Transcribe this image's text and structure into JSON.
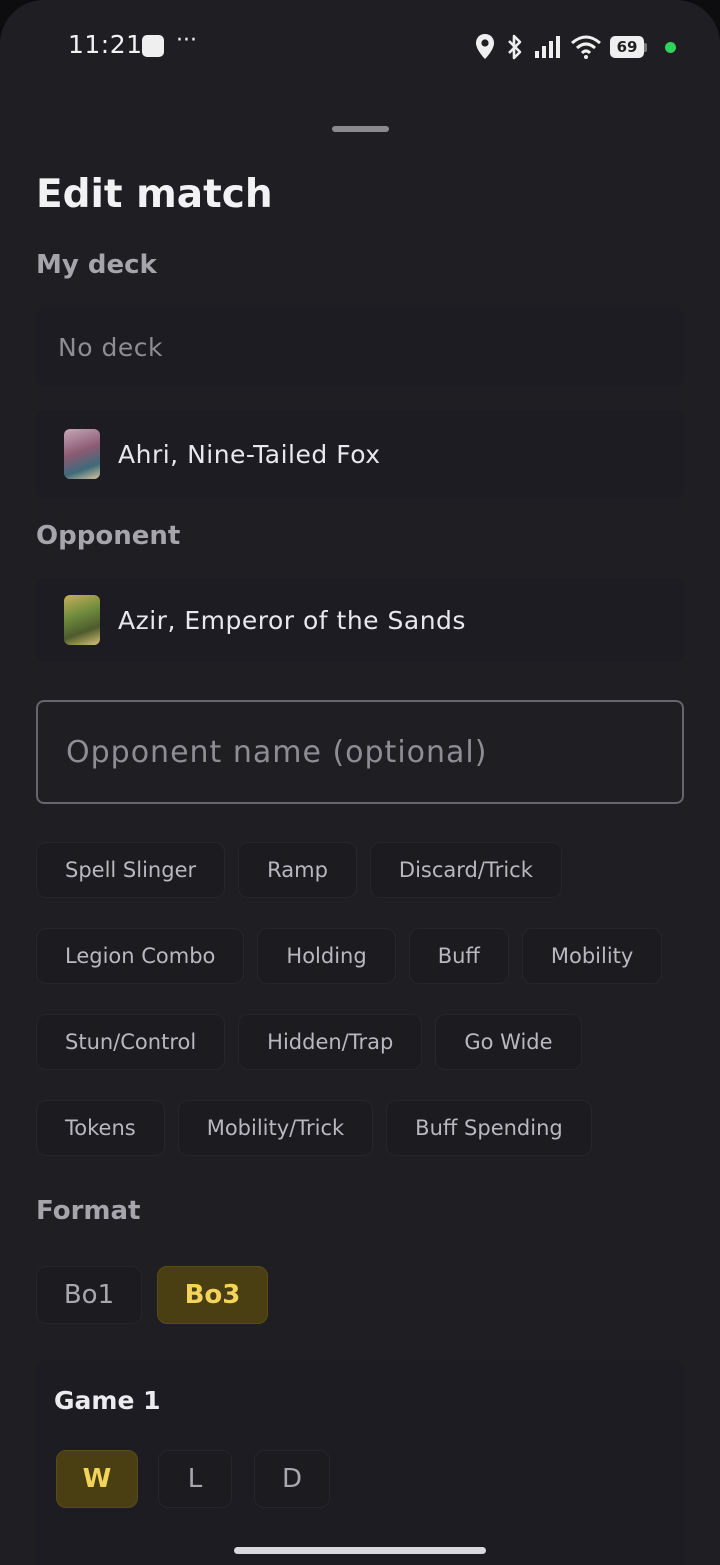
{
  "status_bar": {
    "time": "11:21",
    "notif_more": "···",
    "battery_level": "69"
  },
  "sheet": {
    "title": "Edit match",
    "my_deck_label": "My deck",
    "no_deck_label": "No deck",
    "my_deck_selected": "Ahri, Nine-Tailed Fox",
    "opponent_label": "Opponent",
    "opponent_deck": "Azir, Emperor of the Sands",
    "opponent_name_placeholder": "Opponent name (optional)"
  },
  "tags": [
    [
      "Spell Slinger",
      "Ramp",
      "Discard/Trick"
    ],
    [
      "Legion Combo",
      "Holding",
      "Buff",
      "Mobility"
    ],
    [
      "Stun/Control",
      "Hidden/Trap",
      "Go Wide"
    ],
    [
      "Tokens",
      "Mobility/Trick",
      "Buff Spending"
    ]
  ],
  "format": {
    "label": "Format",
    "options": [
      "Bo1",
      "Bo3"
    ],
    "selected": "Bo3"
  },
  "game1": {
    "label": "Game 1",
    "results": [
      "W",
      "L",
      "D"
    ],
    "selected": "W"
  },
  "colors": {
    "background": "#1f1e22",
    "card": "#1c1c22",
    "accent_bg": "#4a3e13",
    "accent_text": "#f3d45a"
  }
}
